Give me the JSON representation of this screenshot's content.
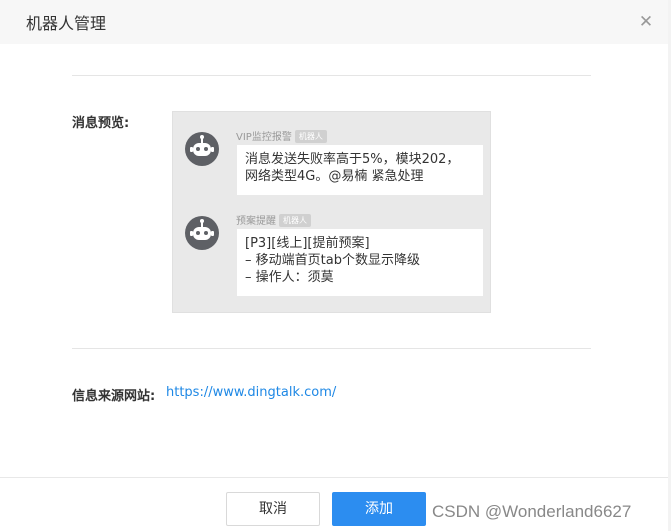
{
  "dialog": {
    "title": "机器人管理",
    "close_icon": "close-icon"
  },
  "preview": {
    "label": "消息预览:",
    "messages": [
      {
        "sender": "VIP监控报警",
        "tag": "机器人",
        "text": "消息发送失败率高于5%，模块202，\n网络类型4G。@易楠 紧急处理"
      },
      {
        "sender": "预案提醒",
        "tag": "机器人",
        "text": "[P3][线上][提前预案]\n– 移动端首页tab个数显示降级\n– 操作人：须莫"
      }
    ]
  },
  "source": {
    "label": "信息来源网站:",
    "url": "https://www.dingtalk.com/"
  },
  "footer": {
    "cancel_label": "取消",
    "add_label": "添加"
  },
  "watermark": "CSDN @Wonderland6627",
  "colors": {
    "primary": "#2c8df0",
    "link": "#1e88e5",
    "avatar": "#5e6065"
  }
}
